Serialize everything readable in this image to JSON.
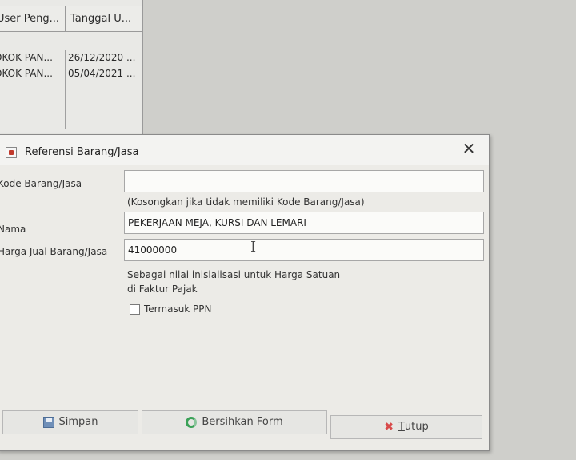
{
  "background_table": {
    "headers": [
      "User Peng...",
      "Tanggal U..."
    ],
    "rows": [
      [
        "OKOK PAN...",
        "26/12/2020 ..."
      ],
      [
        "OKOK PAN...",
        "05/04/2021 ..."
      ],
      [
        "",
        ""
      ],
      [
        "",
        ""
      ],
      [
        "",
        ""
      ]
    ]
  },
  "dialog": {
    "title": "Referensi Barang/Jasa",
    "close_symbol": "✕",
    "labels": {
      "kode": "Kode Barang/Jasa",
      "nama": "Nama",
      "harga": "Harga Jual Barang/Jasa"
    },
    "fields": {
      "kode_value": "",
      "nama_value": "PEKERJAAN MEJA, KURSI DAN LEMARI",
      "harga_value": "41000000"
    },
    "hints": {
      "kode_hint": "(Kosongkan jika tidak memiliki Kode Barang/Jasa)",
      "harga_hint_line1": "Sebagai nilai inisialisasi untuk Harga Satuan",
      "harga_hint_line2": "di Faktur Pajak"
    },
    "checkbox": {
      "label": "Termasuk PPN",
      "checked": false
    },
    "buttons": {
      "simpan_mnemonic": "S",
      "simpan_rest": "impan",
      "bersihkan_mnemonic": "B",
      "bersihkan_rest": "ersihkan Form",
      "tutup_mnemonic": "T",
      "tutup_rest": "utup"
    },
    "icons": {
      "title": "window-icon",
      "save": "floppy-disk-icon",
      "clear": "refresh-icon",
      "close": "red-x-icon"
    }
  },
  "cursor_glyph": "I"
}
